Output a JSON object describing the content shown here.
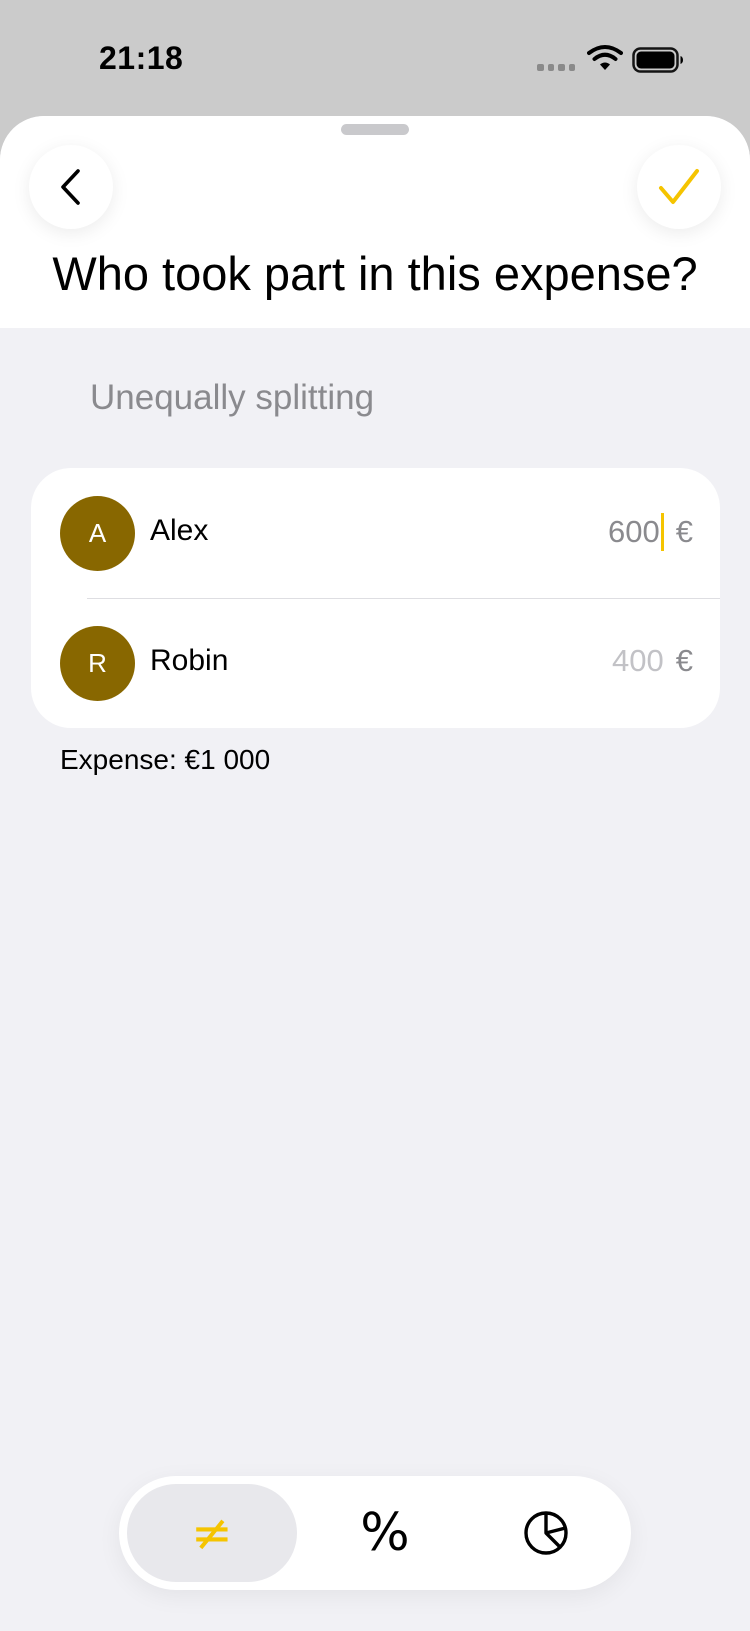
{
  "status_bar": {
    "time": "21:18"
  },
  "header": {
    "title": "Who took part in this expense?",
    "back_icon": "chevron-left-icon",
    "confirm_icon": "checkmark-icon"
  },
  "split": {
    "mode_label": "Unequally splitting",
    "participants": [
      {
        "initial": "A",
        "name": "Alex",
        "amount": "600",
        "currency": "€",
        "focused": true
      },
      {
        "initial": "R",
        "name": "Robin",
        "amount": "400",
        "currency": "€",
        "focused": false
      }
    ],
    "expense_total": "Expense: €1 000"
  },
  "mode_switch": {
    "unequal_glyph": "≠",
    "percent_glyph": "%",
    "shares_icon": "pie-chart-icon",
    "selected": "unequal"
  },
  "colors": {
    "accent": "#f5c400",
    "avatar": "#886700",
    "background": "#f1f1f5",
    "secondary_text": "#8a8a8e"
  }
}
